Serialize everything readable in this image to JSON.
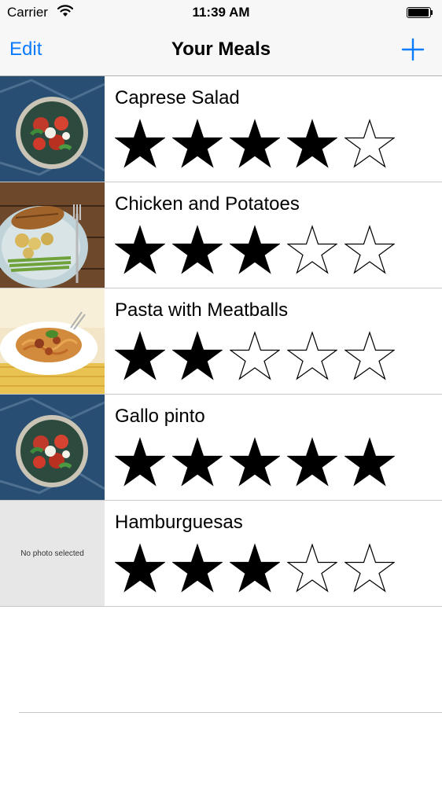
{
  "status_bar": {
    "carrier": "Carrier",
    "time": "11:39 AM"
  },
  "nav": {
    "edit_label": "Edit",
    "title": "Your Meals",
    "add_icon": "plus-icon"
  },
  "meals": [
    {
      "name": "Caprese Salad",
      "rating": 4,
      "photo": "salad"
    },
    {
      "name": "Chicken and Potatoes",
      "rating": 3,
      "photo": "chicken"
    },
    {
      "name": "Pasta with Meatballs",
      "rating": 2,
      "photo": "pasta"
    },
    {
      "name": "Gallo pinto",
      "rating": 5,
      "photo": "salad"
    },
    {
      "name": "Hamburguesas",
      "rating": 3,
      "photo": "none",
      "placeholder_text": "No photo selected"
    }
  ],
  "rating_max": 5,
  "colors": {
    "accent": "#0a7aff",
    "bar_background": "#f7f7f7",
    "separator": "#c8c7cc"
  }
}
